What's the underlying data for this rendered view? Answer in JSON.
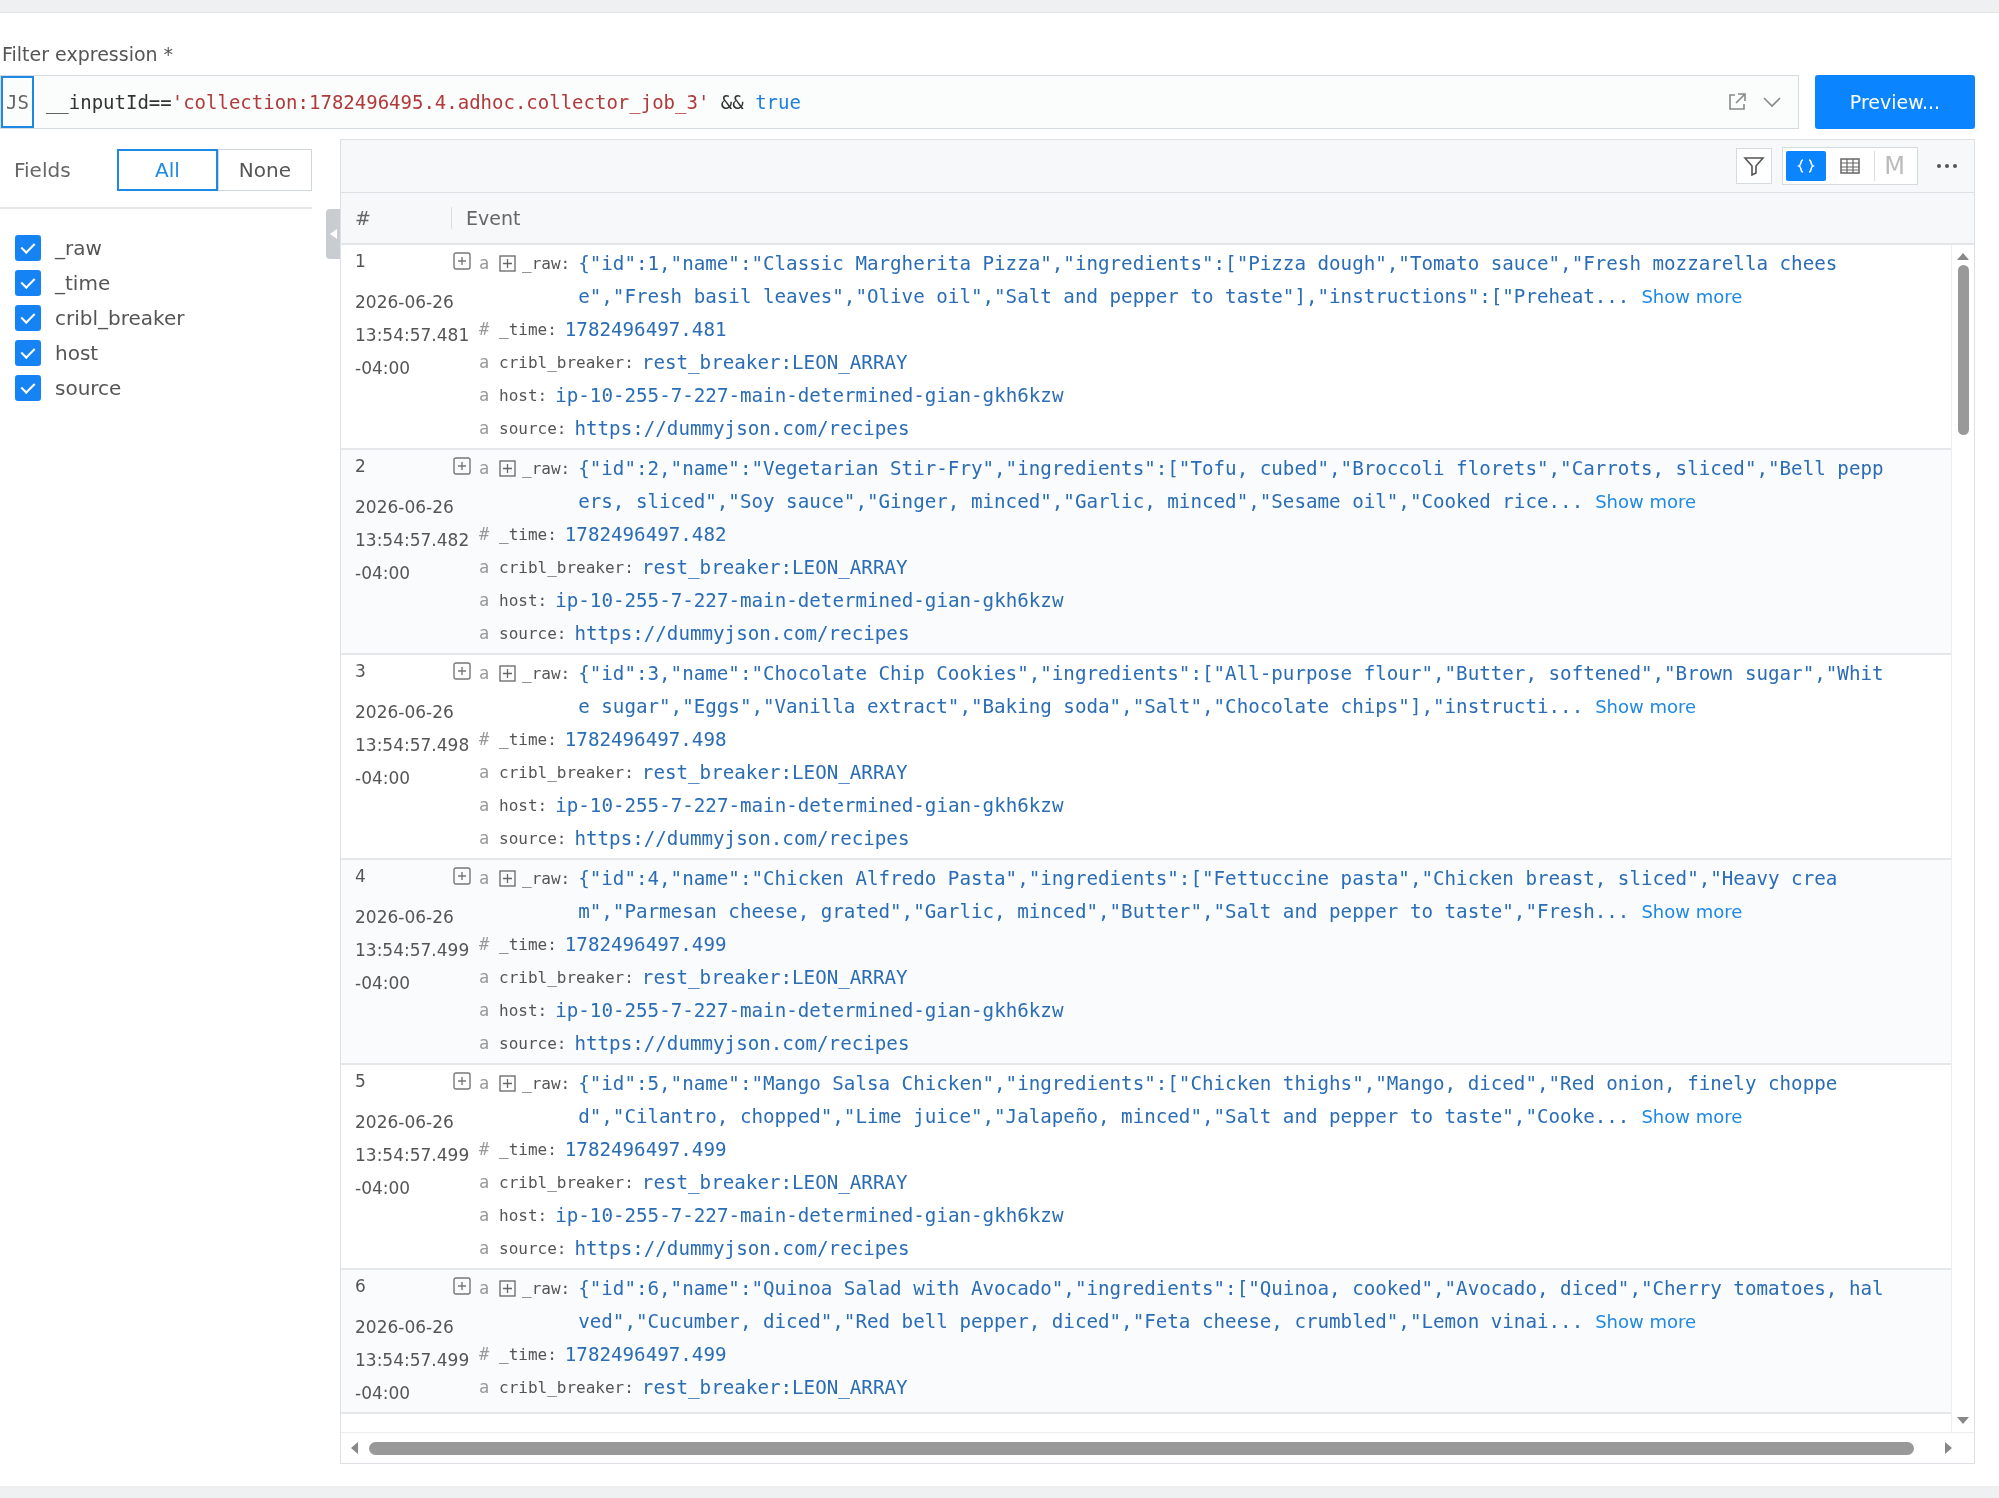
{
  "filter": {
    "label": "Filter expression *",
    "lang_badge": "JS",
    "tokens": [
      {
        "kind": "ident",
        "text": "__inputId=="
      },
      {
        "kind": "string",
        "text": "'collection:1782496495.4.adhoc.collector_job_3'"
      },
      {
        "kind": "op",
        "text": " && "
      },
      {
        "kind": "keyword",
        "text": "true"
      }
    ],
    "preview_button": "Preview..."
  },
  "fields_panel": {
    "title": "Fields",
    "toggle": [
      {
        "label": "All",
        "selected": true
      },
      {
        "label": "None",
        "selected": false
      }
    ],
    "fields": [
      {
        "name": "_raw",
        "checked": true
      },
      {
        "name": "_time",
        "checked": true
      },
      {
        "name": "cribl_breaker",
        "checked": true
      },
      {
        "name": "host",
        "checked": true
      },
      {
        "name": "source",
        "checked": true
      }
    ]
  },
  "toolbar": {
    "views": [
      {
        "kind": "json",
        "selected": true
      },
      {
        "kind": "table",
        "selected": false
      },
      {
        "kind": "text",
        "label": "M",
        "selected": false
      }
    ]
  },
  "table": {
    "columns": [
      "#",
      "Event"
    ],
    "rows": [
      {
        "index": "1",
        "date": "2026-06-26",
        "time": "13:54:57.481",
        "tz": "-04:00",
        "raw_type": "a",
        "raw_key": "_raw:",
        "raw": [
          "{\"id\":1,\"name\":\"Classic Margherita Pizza\",\"ingredients\":[\"Pizza dough\",\"Tomato sauce\",\"Fresh mozzarella chees",
          "e\",\"Fresh basil leaves\",\"Olive oil\",\"Salt and pepper to taste\"],\"instructions\":[\"Preheat..."
        ],
        "show_more": "Show more",
        "fields": [
          {
            "type": "#",
            "key": "_time:",
            "value": "1782496497.481"
          },
          {
            "type": "a",
            "key": "cribl_breaker:",
            "value": "rest_breaker:LEON_ARRAY"
          },
          {
            "type": "a",
            "key": "host:",
            "value": "ip-10-255-7-227-main-determined-gian-gkh6kzw"
          },
          {
            "type": "a",
            "key": "source:",
            "value": "https://dummyjson.com/recipes"
          }
        ]
      },
      {
        "index": "2",
        "date": "2026-06-26",
        "time": "13:54:57.482",
        "tz": "-04:00",
        "raw_type": "a",
        "raw_key": "_raw:",
        "raw": [
          "{\"id\":2,\"name\":\"Vegetarian Stir-Fry\",\"ingredients\":[\"Tofu, cubed\",\"Broccoli florets\",\"Carrots, sliced\",\"Bell pepp",
          "ers, sliced\",\"Soy sauce\",\"Ginger, minced\",\"Garlic, minced\",\"Sesame oil\",\"Cooked rice..."
        ],
        "show_more": "Show more",
        "fields": [
          {
            "type": "#",
            "key": "_time:",
            "value": "1782496497.482"
          },
          {
            "type": "a",
            "key": "cribl_breaker:",
            "value": "rest_breaker:LEON_ARRAY"
          },
          {
            "type": "a",
            "key": "host:",
            "value": "ip-10-255-7-227-main-determined-gian-gkh6kzw"
          },
          {
            "type": "a",
            "key": "source:",
            "value": "https://dummyjson.com/recipes"
          }
        ]
      },
      {
        "index": "3",
        "date": "2026-06-26",
        "time": "13:54:57.498",
        "tz": "-04:00",
        "raw_type": "a",
        "raw_key": "_raw:",
        "raw": [
          "{\"id\":3,\"name\":\"Chocolate Chip Cookies\",\"ingredients\":[\"All-purpose flour\",\"Butter, softened\",\"Brown sugar\",\"Whit",
          "e sugar\",\"Eggs\",\"Vanilla extract\",\"Baking soda\",\"Salt\",\"Chocolate chips\"],\"instructi..."
        ],
        "show_more": "Show more",
        "fields": [
          {
            "type": "#",
            "key": "_time:",
            "value": "1782496497.498"
          },
          {
            "type": "a",
            "key": "cribl_breaker:",
            "value": "rest_breaker:LEON_ARRAY"
          },
          {
            "type": "a",
            "key": "host:",
            "value": "ip-10-255-7-227-main-determined-gian-gkh6kzw"
          },
          {
            "type": "a",
            "key": "source:",
            "value": "https://dummyjson.com/recipes"
          }
        ]
      },
      {
        "index": "4",
        "date": "2026-06-26",
        "time": "13:54:57.499",
        "tz": "-04:00",
        "raw_type": "a",
        "raw_key": "_raw:",
        "raw": [
          "{\"id\":4,\"name\":\"Chicken Alfredo Pasta\",\"ingredients\":[\"Fettuccine pasta\",\"Chicken breast, sliced\",\"Heavy crea",
          "m\",\"Parmesan cheese, grated\",\"Garlic, minced\",\"Butter\",\"Salt and pepper to taste\",\"Fresh..."
        ],
        "show_more": "Show more",
        "fields": [
          {
            "type": "#",
            "key": "_time:",
            "value": "1782496497.499"
          },
          {
            "type": "a",
            "key": "cribl_breaker:",
            "value": "rest_breaker:LEON_ARRAY"
          },
          {
            "type": "a",
            "key": "host:",
            "value": "ip-10-255-7-227-main-determined-gian-gkh6kzw"
          },
          {
            "type": "a",
            "key": "source:",
            "value": "https://dummyjson.com/recipes"
          }
        ]
      },
      {
        "index": "5",
        "date": "2026-06-26",
        "time": "13:54:57.499",
        "tz": "-04:00",
        "raw_type": "a",
        "raw_key": "_raw:",
        "raw": [
          "{\"id\":5,\"name\":\"Mango Salsa Chicken\",\"ingredients\":[\"Chicken thighs\",\"Mango, diced\",\"Red onion, finely choppe",
          "d\",\"Cilantro, chopped\",\"Lime juice\",\"Jalapeño, minced\",\"Salt and pepper to taste\",\"Cooke..."
        ],
        "show_more": "Show more",
        "fields": [
          {
            "type": "#",
            "key": "_time:",
            "value": "1782496497.499"
          },
          {
            "type": "a",
            "key": "cribl_breaker:",
            "value": "rest_breaker:LEON_ARRAY"
          },
          {
            "type": "a",
            "key": "host:",
            "value": "ip-10-255-7-227-main-determined-gian-gkh6kzw"
          },
          {
            "type": "a",
            "key": "source:",
            "value": "https://dummyjson.com/recipes"
          }
        ]
      },
      {
        "index": "6",
        "date": "2026-06-26",
        "time": "13:54:57.499",
        "tz": "-04:00",
        "raw_type": "a",
        "raw_key": "_raw:",
        "raw": [
          "{\"id\":6,\"name\":\"Quinoa Salad with Avocado\",\"ingredients\":[\"Quinoa, cooked\",\"Avocado, diced\",\"Cherry tomatoes, hal",
          "ved\",\"Cucumber, diced\",\"Red bell pepper, diced\",\"Feta cheese, crumbled\",\"Lemon vinai..."
        ],
        "show_more": "Show more",
        "fields": [
          {
            "type": "#",
            "key": "_time:",
            "value": "1782496497.499"
          },
          {
            "type": "a",
            "key": "cribl_breaker:",
            "value": "rest_breaker:LEON_ARRAY"
          }
        ]
      }
    ]
  }
}
